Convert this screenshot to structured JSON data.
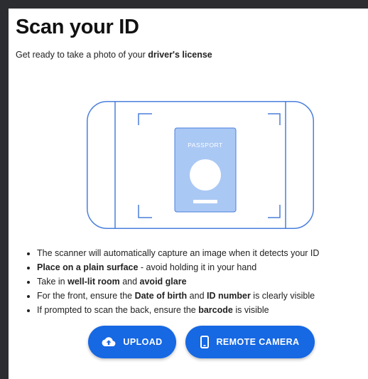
{
  "header": {
    "title": "Scan your ID",
    "subtitle_prefix": "Get ready to take a photo of your ",
    "subtitle_bold": "driver's license"
  },
  "illustration": {
    "card_label": "PASSPORT",
    "icon": "scan-frame-with-passport"
  },
  "tips": [
    {
      "parts": [
        {
          "text": "The scanner will automatically capture an image when it detects your ID",
          "bold": false
        }
      ]
    },
    {
      "parts": [
        {
          "text": "Place on a plain surface",
          "bold": true
        },
        {
          "text": " - avoid holding it in your hand",
          "bold": false
        }
      ]
    },
    {
      "parts": [
        {
          "text": "Take in ",
          "bold": false
        },
        {
          "text": "well-lit room",
          "bold": true
        },
        {
          "text": " and ",
          "bold": false
        },
        {
          "text": "avoid glare",
          "bold": true
        }
      ]
    },
    {
      "parts": [
        {
          "text": "For the front, ensure the ",
          "bold": false
        },
        {
          "text": "Date of birth",
          "bold": true
        },
        {
          "text": " and ",
          "bold": false
        },
        {
          "text": "ID number",
          "bold": true
        },
        {
          "text": " is clearly visible",
          "bold": false
        }
      ]
    },
    {
      "parts": [
        {
          "text": "If prompted to scan the back, ensure the ",
          "bold": false
        },
        {
          "text": "barcode",
          "bold": true
        },
        {
          "text": " is visible",
          "bold": false
        }
      ]
    }
  ],
  "buttons": {
    "upload_label": "UPLOAD",
    "upload_icon": "cloud-upload-icon",
    "remote_label": "REMOTE CAMERA",
    "remote_icon": "phone-icon"
  },
  "colors": {
    "accent": "#1668e3",
    "illustration_stroke": "#4a7fdc",
    "card_fill": "#aac8f4",
    "background": "#2b2d30"
  }
}
